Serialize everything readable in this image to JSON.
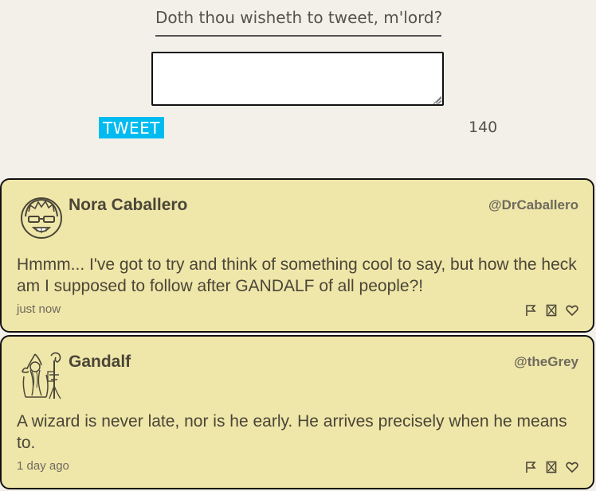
{
  "composer": {
    "prompt": "Doth thou wisheth to tweet, m'lord?",
    "input_value": "",
    "tweet_button": "TWEET",
    "char_count": "140"
  },
  "tweets": [
    {
      "name": "Nora Caballero",
      "handle": "@DrCaballero",
      "text": "Hmmm... I've got to try and think of something cool to say, but how the heck am I supposed to follow after GANDALF of all people?!",
      "time": "just now",
      "avatar_icon": "hacker-avatar-icon",
      "actions": [
        "flag-icon",
        "retweet-icon",
        "heart-icon"
      ]
    },
    {
      "name": "Gandalf",
      "handle": "@theGrey",
      "text": "A wizard is never late, nor is he early. He arrives precisely when he means to.",
      "time": "1 day ago",
      "avatar_icon": "wizard-avatar-icon",
      "actions": [
        "flag-icon",
        "retweet-icon",
        "heart-icon"
      ]
    }
  ],
  "colors": {
    "background": "#f3f0ea",
    "card": "#efe6a9",
    "button": "#00bbf0"
  }
}
